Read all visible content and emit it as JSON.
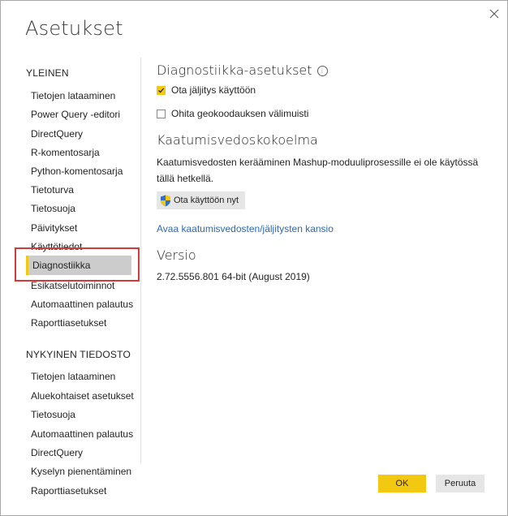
{
  "dialog": {
    "title": "Asetukset",
    "close_icon": "close-icon"
  },
  "sidebar": {
    "general_heading": "YLEINEN",
    "general_items": [
      {
        "label": "Tietojen lataaminen"
      },
      {
        "label": "Power Query -editori"
      },
      {
        "label": "DirectQuery"
      },
      {
        "label": "R-komentosarja"
      },
      {
        "label": "Python-komentosarja"
      },
      {
        "label": "Tietoturva"
      },
      {
        "label": "Tietosuoja"
      },
      {
        "label": "Päivitykset"
      },
      {
        "label": "Käyttötiedot"
      },
      {
        "label": "Diagnostiikka",
        "selected": true
      },
      {
        "label": "Esikatselutoiminnot"
      },
      {
        "label": "Automaattinen palautus"
      },
      {
        "label": "Raporttiasetukset"
      }
    ],
    "current_heading": "NYKYINEN TIEDOSTO",
    "current_items": [
      {
        "label": "Tietojen lataaminen"
      },
      {
        "label": "Aluekohtaiset asetukset"
      },
      {
        "label": "Tietosuoja"
      },
      {
        "label": "Automaattinen palautus"
      },
      {
        "label": "DirectQuery"
      },
      {
        "label": "Kyselyn pienentäminen"
      },
      {
        "label": "Raporttiasetukset"
      }
    ],
    "highlight_color": "#d23b3b"
  },
  "main": {
    "diagnostics_heading": "Diagnostiikka-asetukset",
    "checkboxes": [
      {
        "label": "Ota jäljitys käyttöön",
        "checked": true
      },
      {
        "label": "Ohita geokoodauksen välimuisti",
        "checked": false
      }
    ],
    "crash_heading": "Kaatumisvedoskokoelma",
    "crash_text": "Kaatumisvedosten kerääminen Mashup-moduuliprosessille ei ole käytössä tällä hetkellä.",
    "enable_button": "Ota käyttöön nyt",
    "enable_icon": "shield-icon",
    "folder_link": "Avaa kaatumisvedosten/jäljitysten kansio",
    "version_heading": "Versio",
    "version_text": "2.72.5556.801 64-bit (August 2019)"
  },
  "footer": {
    "ok_label": "OK",
    "cancel_label": "Peruuta"
  },
  "colors": {
    "accent": "#f2c811",
    "link": "#2f68b0",
    "selected_bg": "#cccccc"
  }
}
